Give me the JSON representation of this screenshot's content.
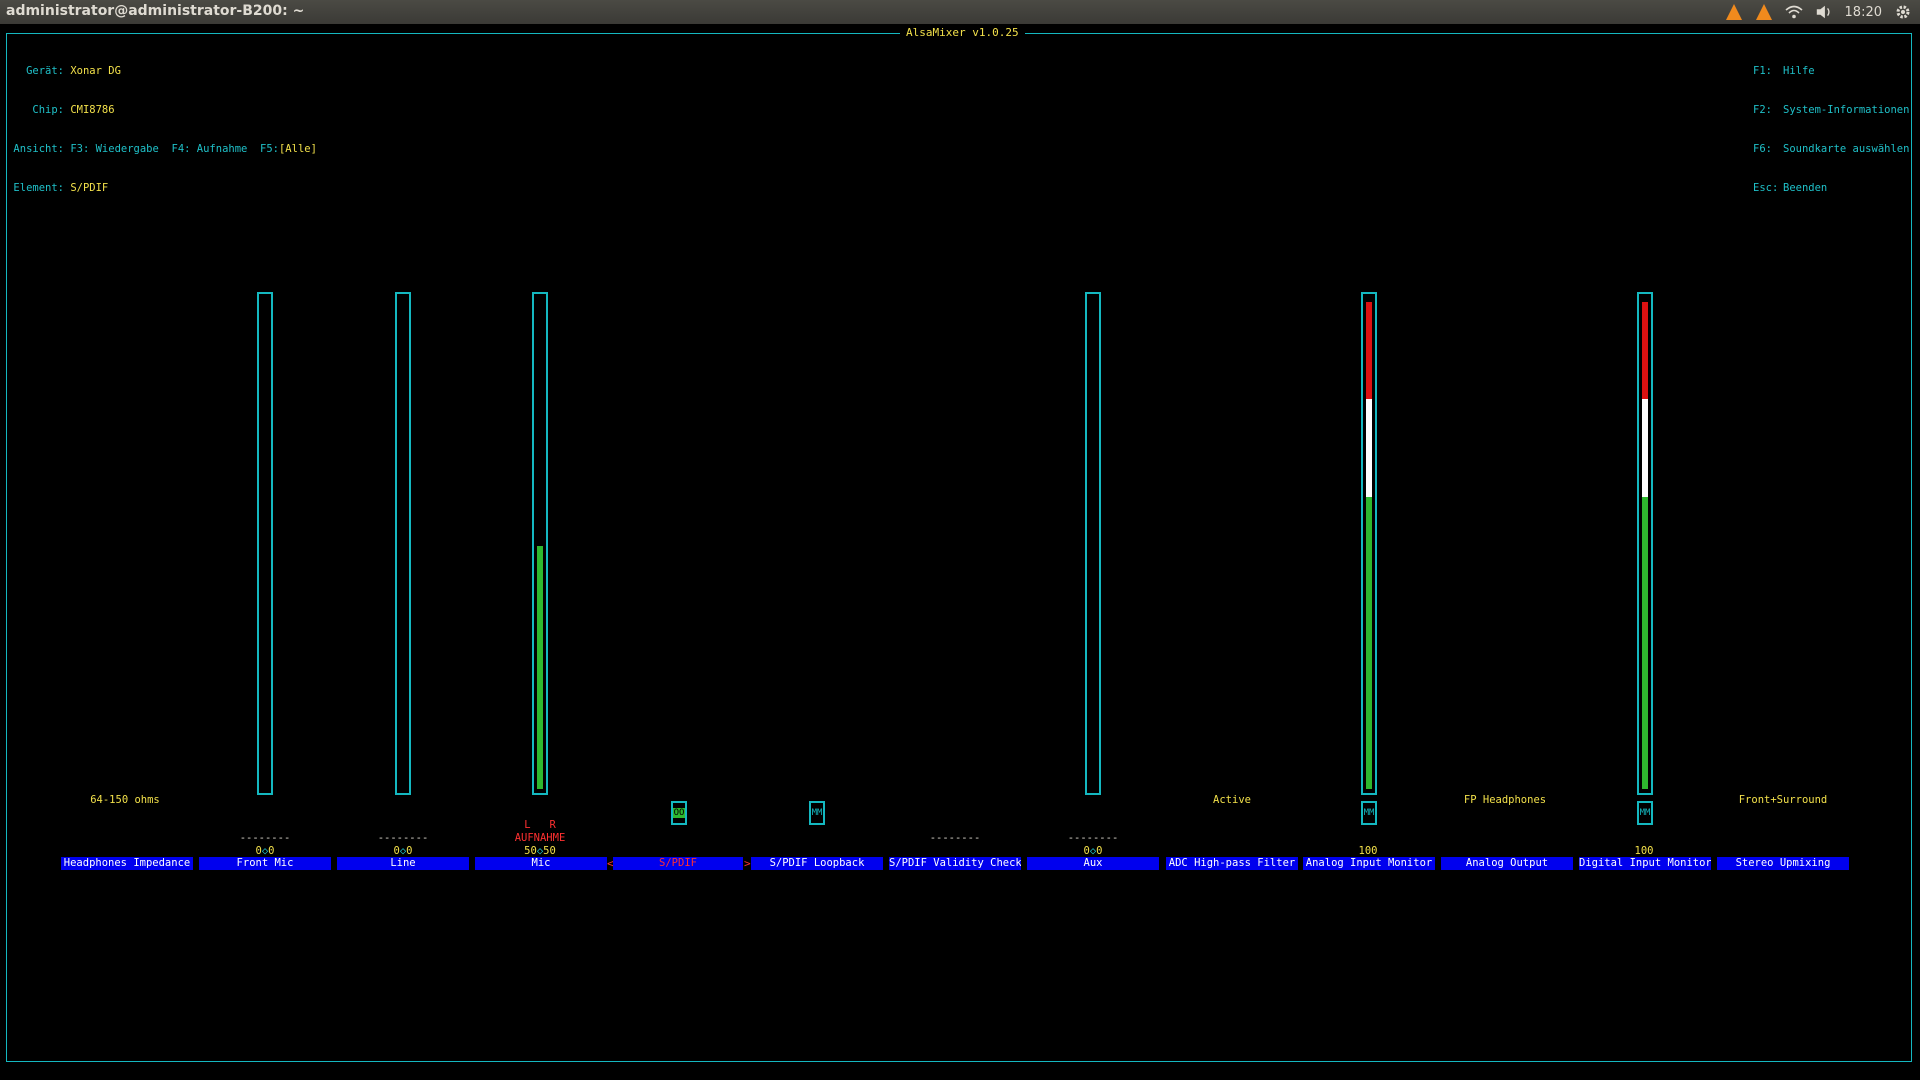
{
  "window": {
    "title": "administrator@administrator-B200: ~"
  },
  "tray": {
    "clock": "18:20",
    "icons": [
      "vlc-icon",
      "vlc-icon",
      "wifi-icon",
      "volume-icon",
      "gear-icon"
    ]
  },
  "app": {
    "title": "AlsaMixer v1.0.25"
  },
  "info": {
    "device_label": "Gerät:",
    "device_value": "Xonar DG",
    "chip_label": "Chip:",
    "chip_value": "CMI8786",
    "view_label": "Ansicht:",
    "view_f3": "F3: Wiedergabe",
    "view_f4": "F4: Aufnahme",
    "view_f5_key": "F5:",
    "view_f5_value": "[Alle]",
    "element_label": "Element:",
    "element_value": "S/PDIF"
  },
  "help": {
    "f1_key": "F1:",
    "f1": "Hilfe",
    "f2_key": "F2:",
    "f2": "System-Informationen",
    "f6_key": "F6:",
    "f6": "Soundkarte auswählen",
    "esc_key": "Esc:",
    "esc": "Beenden"
  },
  "mixer": {
    "selected": "S/PDIF",
    "controls": [
      {
        "name": "Headphones Impedance",
        "extra": "64-150 ohms"
      },
      {
        "name": "Front Mic",
        "level": 0,
        "dashes": "--------",
        "value_l": "0",
        "value_r": "0"
      },
      {
        "name": "Line",
        "level": 0,
        "dashes": "--------",
        "value_l": "0",
        "value_r": "0"
      },
      {
        "name": "Mic",
        "level": 0.5,
        "capture_l": "L",
        "capture_r": "R",
        "capture": "AUFNAHME",
        "value_l": "50",
        "value_r": "50"
      },
      {
        "name": "S/PDIF",
        "switch": "OO"
      },
      {
        "name": "S/PDIF Loopback",
        "switch": "MM"
      },
      {
        "name": "S/PDIF Validity Check",
        "dashes": "--------"
      },
      {
        "name": "Aux",
        "level": 0,
        "dashes": "--------",
        "value_l": "0",
        "value_r": "0"
      },
      {
        "name": "ADC High-pass Filter",
        "extra": "Active"
      },
      {
        "name": "Analog Input Monitor",
        "level": 1.0,
        "switch": "MM",
        "value": "100"
      },
      {
        "name": "Analog Output",
        "extra": "FP Headphones"
      },
      {
        "name": "Digital Input Monitor",
        "level": 1.0,
        "switch": "MM",
        "value": "100"
      },
      {
        "name": "Stereo Upmixing",
        "extra": "Front+Surround"
      }
    ]
  },
  "colors": {
    "frame": "#14b8c0",
    "label_bg": "#0000ee",
    "green": "#2eb82e",
    "white": "#ffffff",
    "red": "#dd1111",
    "yellow": "#f2e04a"
  }
}
